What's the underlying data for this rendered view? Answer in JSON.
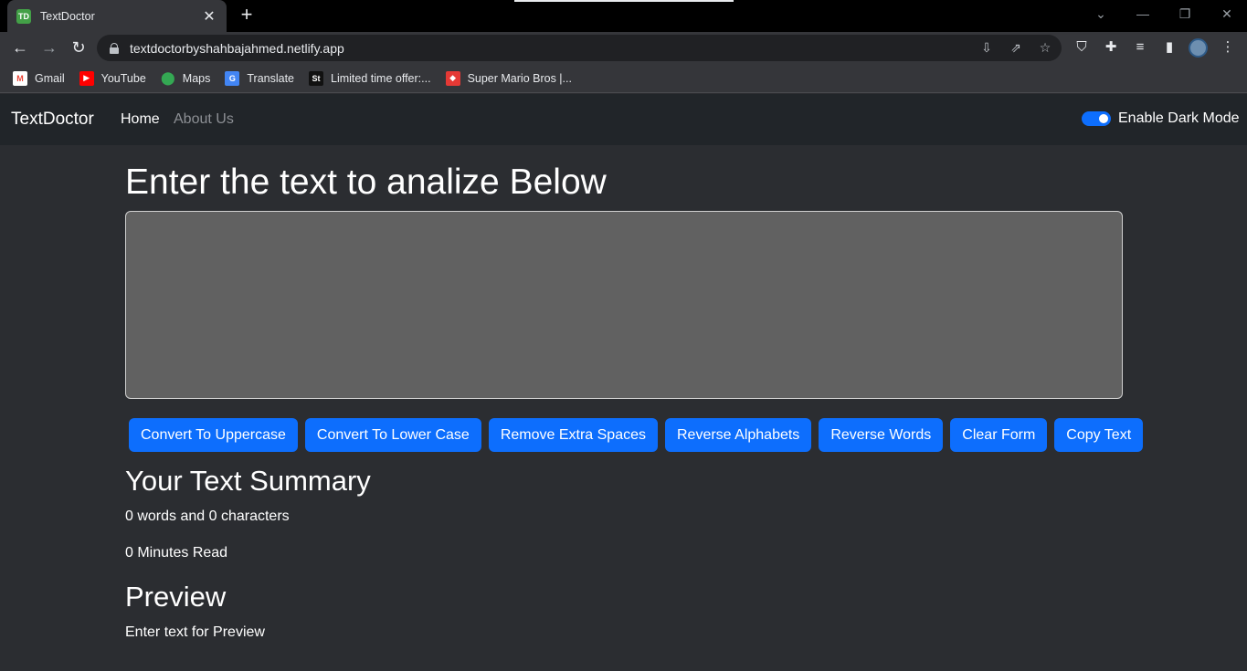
{
  "browser": {
    "tab_title": "TextDoctor",
    "favicon_text": "TD",
    "url": "textdoctorbyshahbajahmed.netlify.app",
    "bookmarks": [
      {
        "label": "Gmail",
        "icon": "gmail-icon",
        "color": "#ea4335"
      },
      {
        "label": "YouTube",
        "icon": "youtube-icon",
        "color": "#ff0000"
      },
      {
        "label": "Maps",
        "icon": "maps-icon",
        "color": "#34a853"
      },
      {
        "label": "Translate",
        "icon": "translate-icon",
        "color": "#4285f4"
      },
      {
        "label": "Limited time offer:...",
        "icon": "st-icon",
        "color": "#111111"
      },
      {
        "label": "Super Mario Bros |...",
        "icon": "mario-icon",
        "color": "#e53935"
      }
    ]
  },
  "navbar": {
    "brand": "TextDoctor",
    "links": [
      {
        "label": "Home",
        "active": true
      },
      {
        "label": "About Us",
        "active": false
      }
    ],
    "dark_mode_label": "Enable Dark Mode",
    "dark_mode_enabled": true
  },
  "main": {
    "heading": "Enter the text to analize Below",
    "textarea_value": "",
    "buttons": [
      "Convert To Uppercase",
      "Convert To Lower Case",
      "Remove Extra Spaces",
      "Reverse Alphabets",
      "Reverse Words",
      "Clear Form",
      "Copy Text"
    ]
  },
  "summary": {
    "title": "Your Text Summary",
    "counts": "0 words and 0 characters",
    "read_time": "0 Minutes Read"
  },
  "preview": {
    "title": "Preview",
    "text": "Enter text for Preview"
  },
  "colors": {
    "accent": "#0d6efd",
    "navbar_bg": "#212529",
    "page_bg": "#2b2d31",
    "textarea_bg": "#616161"
  }
}
